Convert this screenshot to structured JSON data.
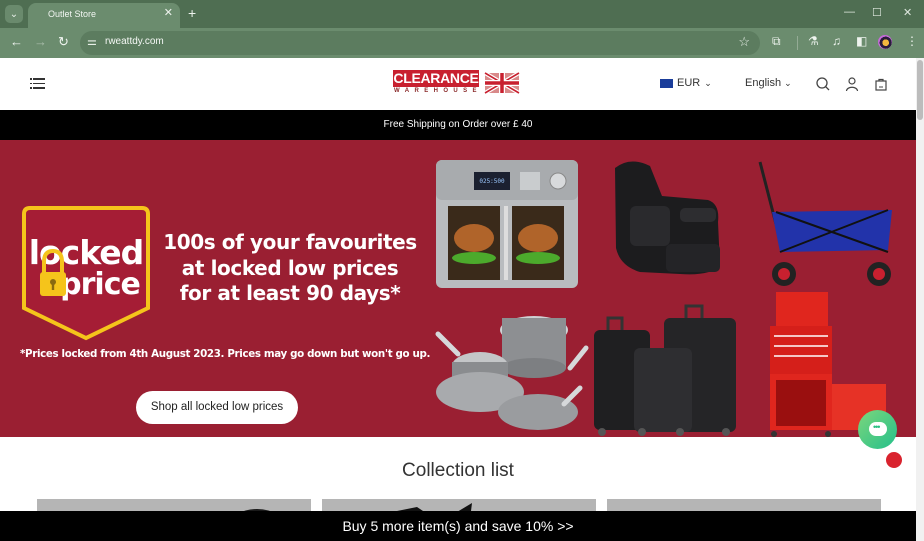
{
  "browser": {
    "tab_title": "Outlet Store",
    "url": "rweattdy.com",
    "icons": {
      "tab_list": "chevron-down-icon",
      "close_tab": "close-icon",
      "new_tab": "plus-icon",
      "back": "arrow-left-icon",
      "forward": "arrow-right-icon",
      "reload": "reload-icon",
      "site_info": "tune-icon",
      "bookmark": "star-icon",
      "extensions": "puzzle-icon",
      "labs": "flask-icon",
      "reading_list": "media-control-icon",
      "side_panel": "side-panel-icon",
      "menu": "kebab-icon"
    },
    "window_controls": {
      "minimize": "—",
      "maximize": "☐",
      "close": "✕"
    }
  },
  "header": {
    "logo_text": "CLEARANCE",
    "logo_subtext": "WAREHOUSE",
    "currency": "EUR",
    "language": "English"
  },
  "announcement": {
    "text": "Free Shipping on Order over £ 40"
  },
  "hero": {
    "badge_word1": "locked",
    "badge_word2": "price",
    "headline_lines": [
      "100s of your favourites",
      "at locked low prices",
      "for at least 90 days*"
    ],
    "disclaimer": "*Prices locked from 4th August 2023. Prices may go down but won't go up.",
    "cta_label": "Shop all locked low prices",
    "products": [
      "Air fryer oven",
      "Recliner chair",
      "Folding wagon",
      "Cookware set",
      "Luggage set",
      "Tool chest"
    ]
  },
  "collection": {
    "title": "Collection list",
    "cards": 3
  },
  "promo_bar": {
    "text": "Buy 5 more item(s) and save 10%  >>"
  },
  "colors": {
    "hero_bg": "#9a1f32",
    "brand_red": "#c8202f",
    "badge_yellow": "#f5c41b",
    "chrome_green": "#6b8c6e",
    "chat_green": "#24c08b"
  }
}
